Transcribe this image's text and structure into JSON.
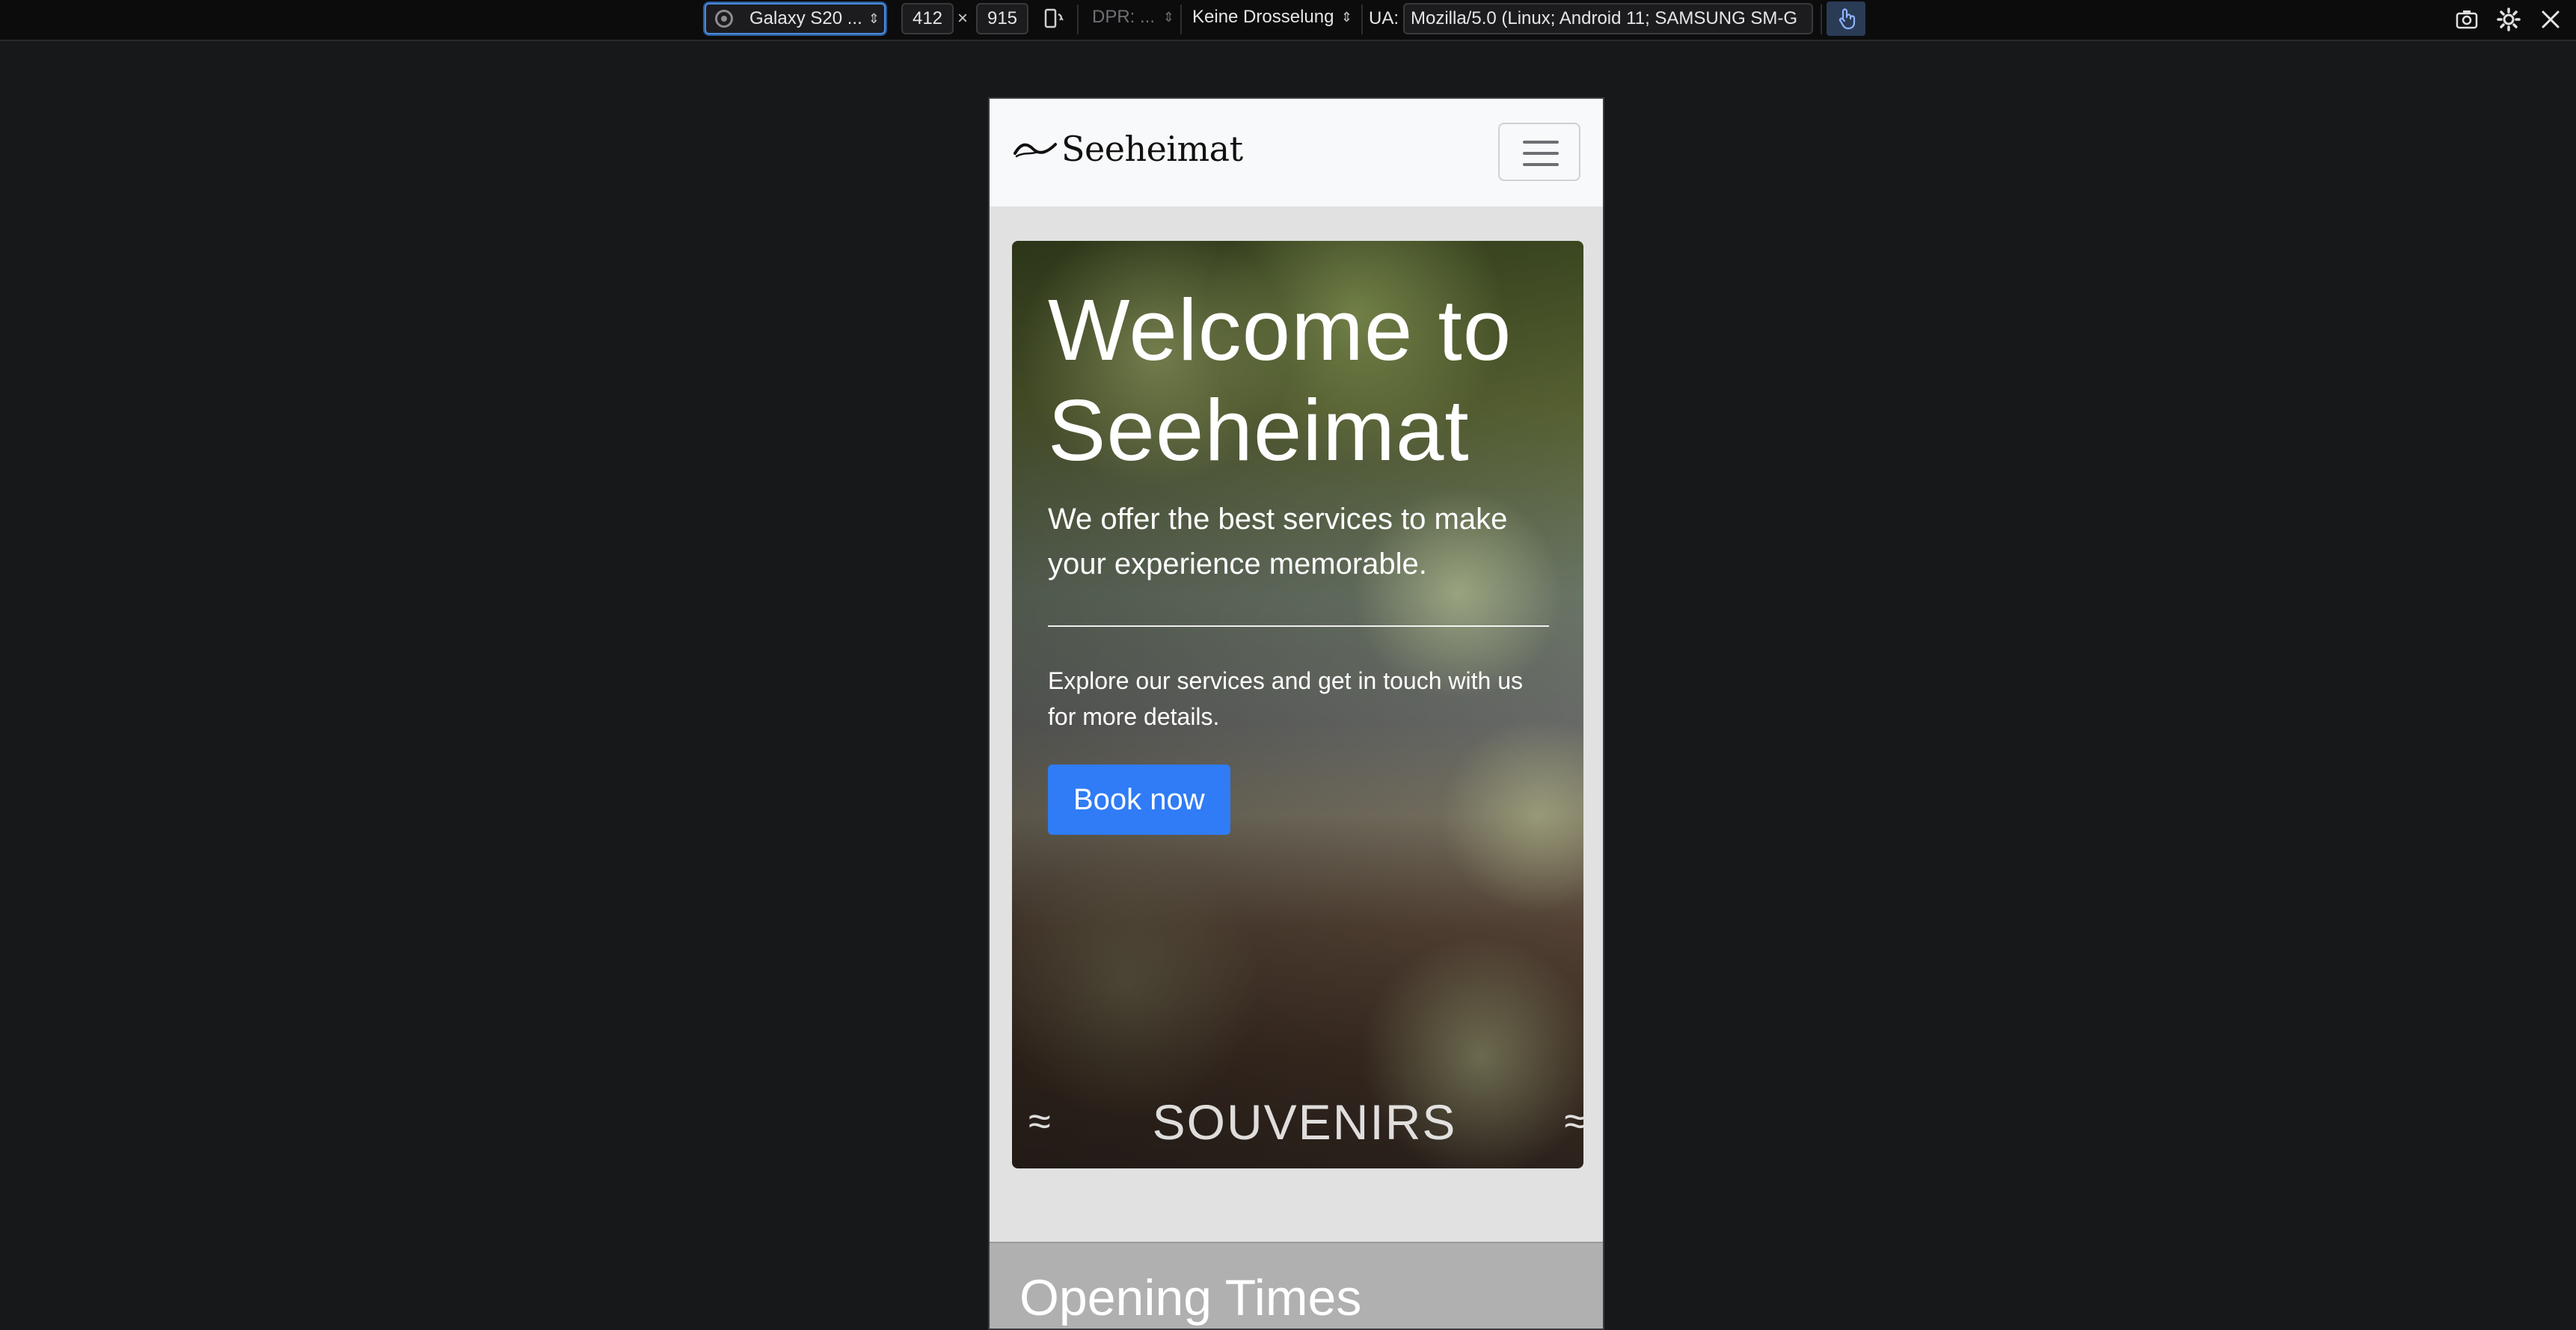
{
  "toolbar": {
    "device": "Galaxy S20 ...",
    "width": "412",
    "height": "915",
    "times": "×",
    "dpr": "DPR: ...",
    "throttling": "Keine Drosselung",
    "ua_label": "UA:",
    "user_agent": "Mozilla/5.0 (Linux; Android 11; SAMSUNG SM-G",
    "icons": [
      "globe-icon",
      "rotate-icon",
      "touch-icon",
      "screenshot-icon",
      "settings-icon",
      "close-icon"
    ],
    "accent": "#4a8ce0"
  },
  "site": {
    "brand": "Seeheimat",
    "hero": {
      "title": "Welcome to Seeheimat",
      "lead": "We offer the best services to make your experience memorable.",
      "text": "Explore our services and get in touch with us for more details.",
      "button": "Book now",
      "button_color": "#2f7cf6",
      "footer_label": "SOUVENIRS",
      "wave_left": "≈",
      "wave_right": "≈"
    },
    "opening": {
      "title": "Opening Times"
    }
  }
}
